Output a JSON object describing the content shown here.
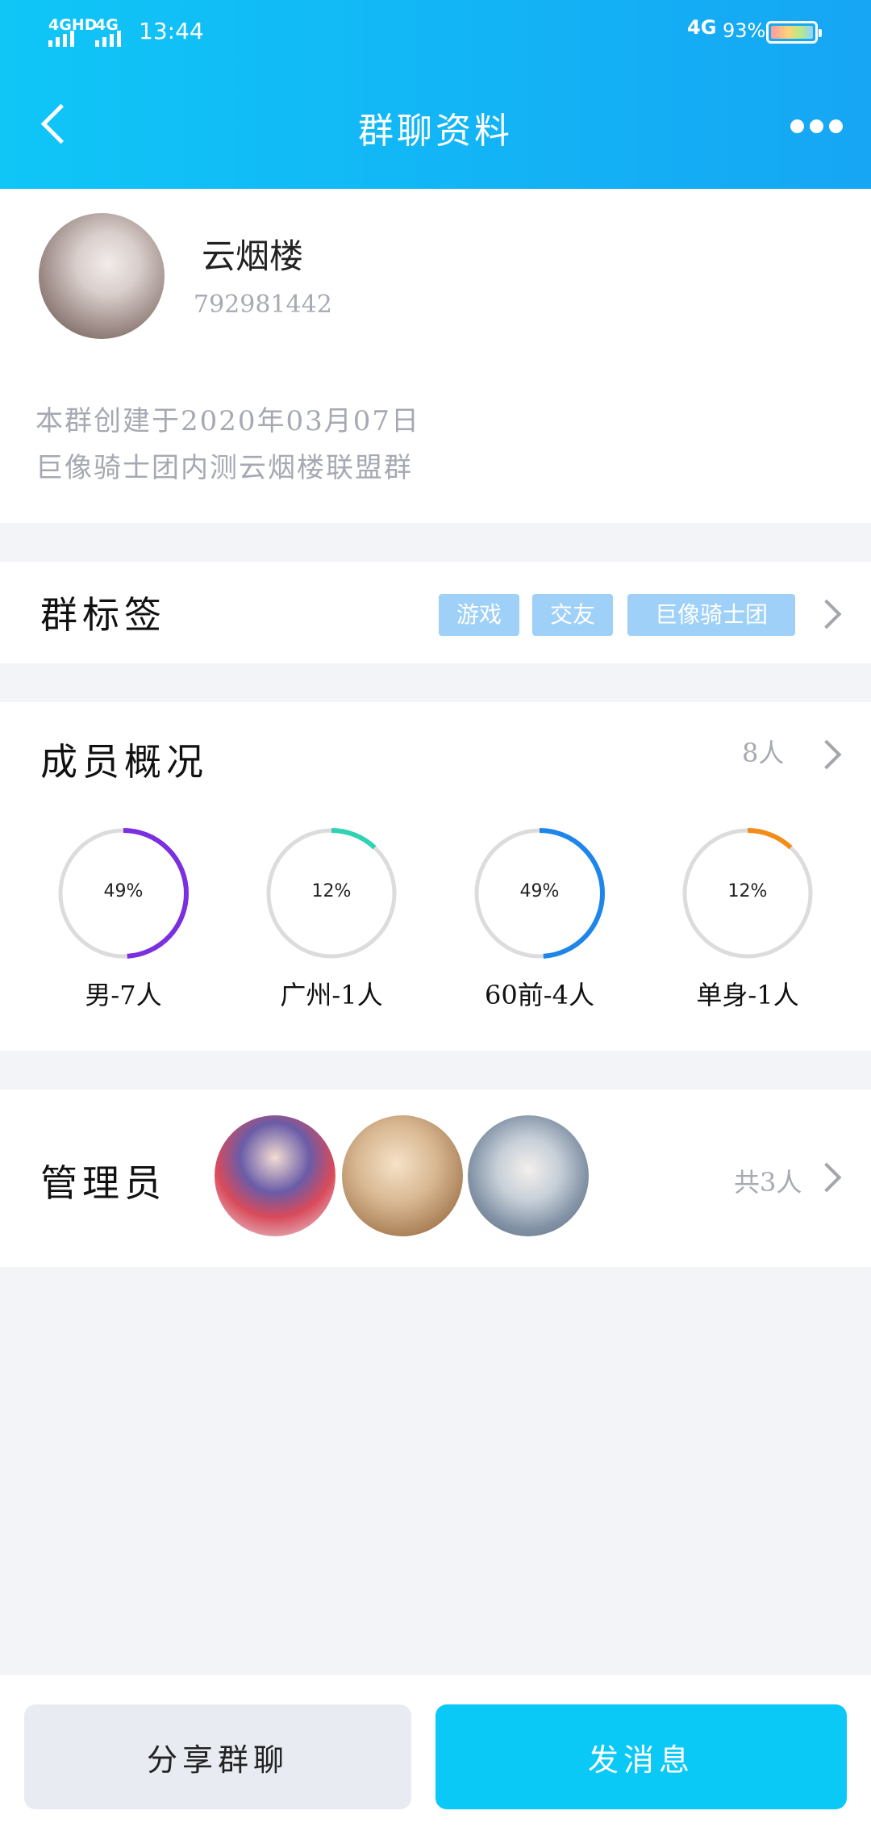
{
  "status_bar": {
    "network_left": "4GHD",
    "network_left2": "4G",
    "time": "13:44",
    "network_right": "4G",
    "battery_percent": "93%"
  },
  "header": {
    "title": "群聊资料"
  },
  "group": {
    "name": "云烟楼",
    "id": "792981442",
    "created": "本群创建于2020年03月07日",
    "description": "巨像骑士团内测云烟楼联盟群"
  },
  "tags": {
    "title": "群标签",
    "items": [
      "游戏",
      "交友",
      "巨像骑士团"
    ]
  },
  "members": {
    "title": "成员概况",
    "count": "8人",
    "stats": [
      {
        "percent": "49%",
        "label": "男-7人",
        "value": 49,
        "color": "#7a2fe0"
      },
      {
        "percent": "12%",
        "label": "广州-1人",
        "value": 12,
        "color": "#2fd2b2"
      },
      {
        "percent": "49%",
        "label": "60前-4人",
        "value": 49,
        "color": "#1e86ea"
      },
      {
        "percent": "12%",
        "label": "单身-1人",
        "value": 12,
        "color": "#f28c1a"
      }
    ]
  },
  "admins": {
    "title": "管理员",
    "count": "共3人"
  },
  "actions": {
    "share": "分享群聊",
    "send": "发消息"
  }
}
